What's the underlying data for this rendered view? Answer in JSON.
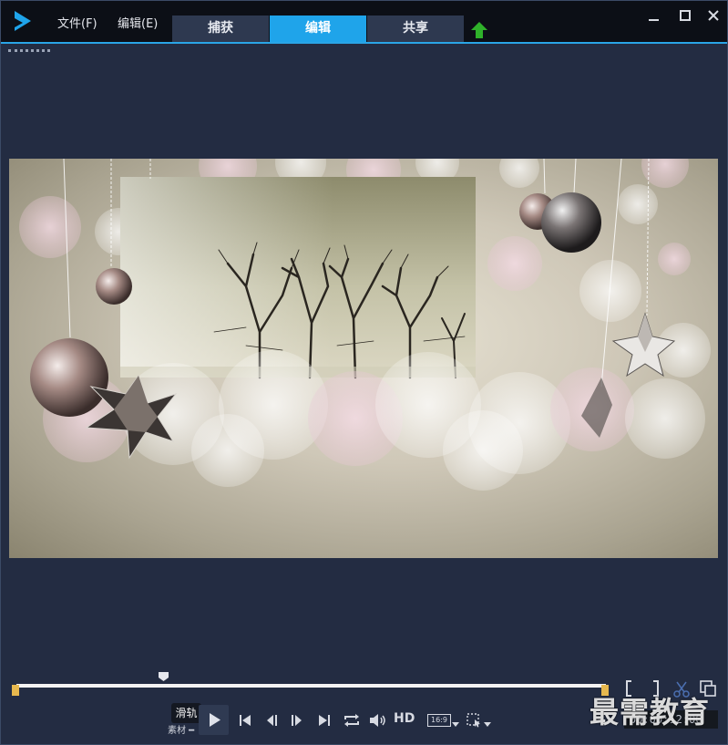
{
  "menu": {
    "file_label": "文件(F)",
    "edit_label": "编辑(E)"
  },
  "tabs": [
    {
      "label": "捕获",
      "active": false
    },
    {
      "label": "编辑",
      "active": true
    },
    {
      "label": "共享",
      "active": false
    }
  ],
  "window_controls": {
    "close": "×",
    "minimize": "—",
    "maximize": "□"
  },
  "colors": {
    "accent": "#1fa4ea",
    "upload_arrow": "#2fb12a",
    "marker": "#e7b84e"
  },
  "player": {
    "tooltip": "滑轨",
    "mode_label": "素材 ━",
    "hd_label": "HD",
    "ratio_label": "16:9",
    "timecode": "00:00:12:00",
    "icons": [
      "play-icon",
      "go-to-start-icon",
      "previous-frame-icon",
      "next-frame-icon",
      "go-to-end-icon",
      "repeat-icon",
      "volume-icon",
      "aspect-ratio-icon",
      "crop-icon",
      "fullscreen-bracket-icon",
      "scissors-icon",
      "preview-window-icon"
    ]
  },
  "watermark": "最需教育"
}
